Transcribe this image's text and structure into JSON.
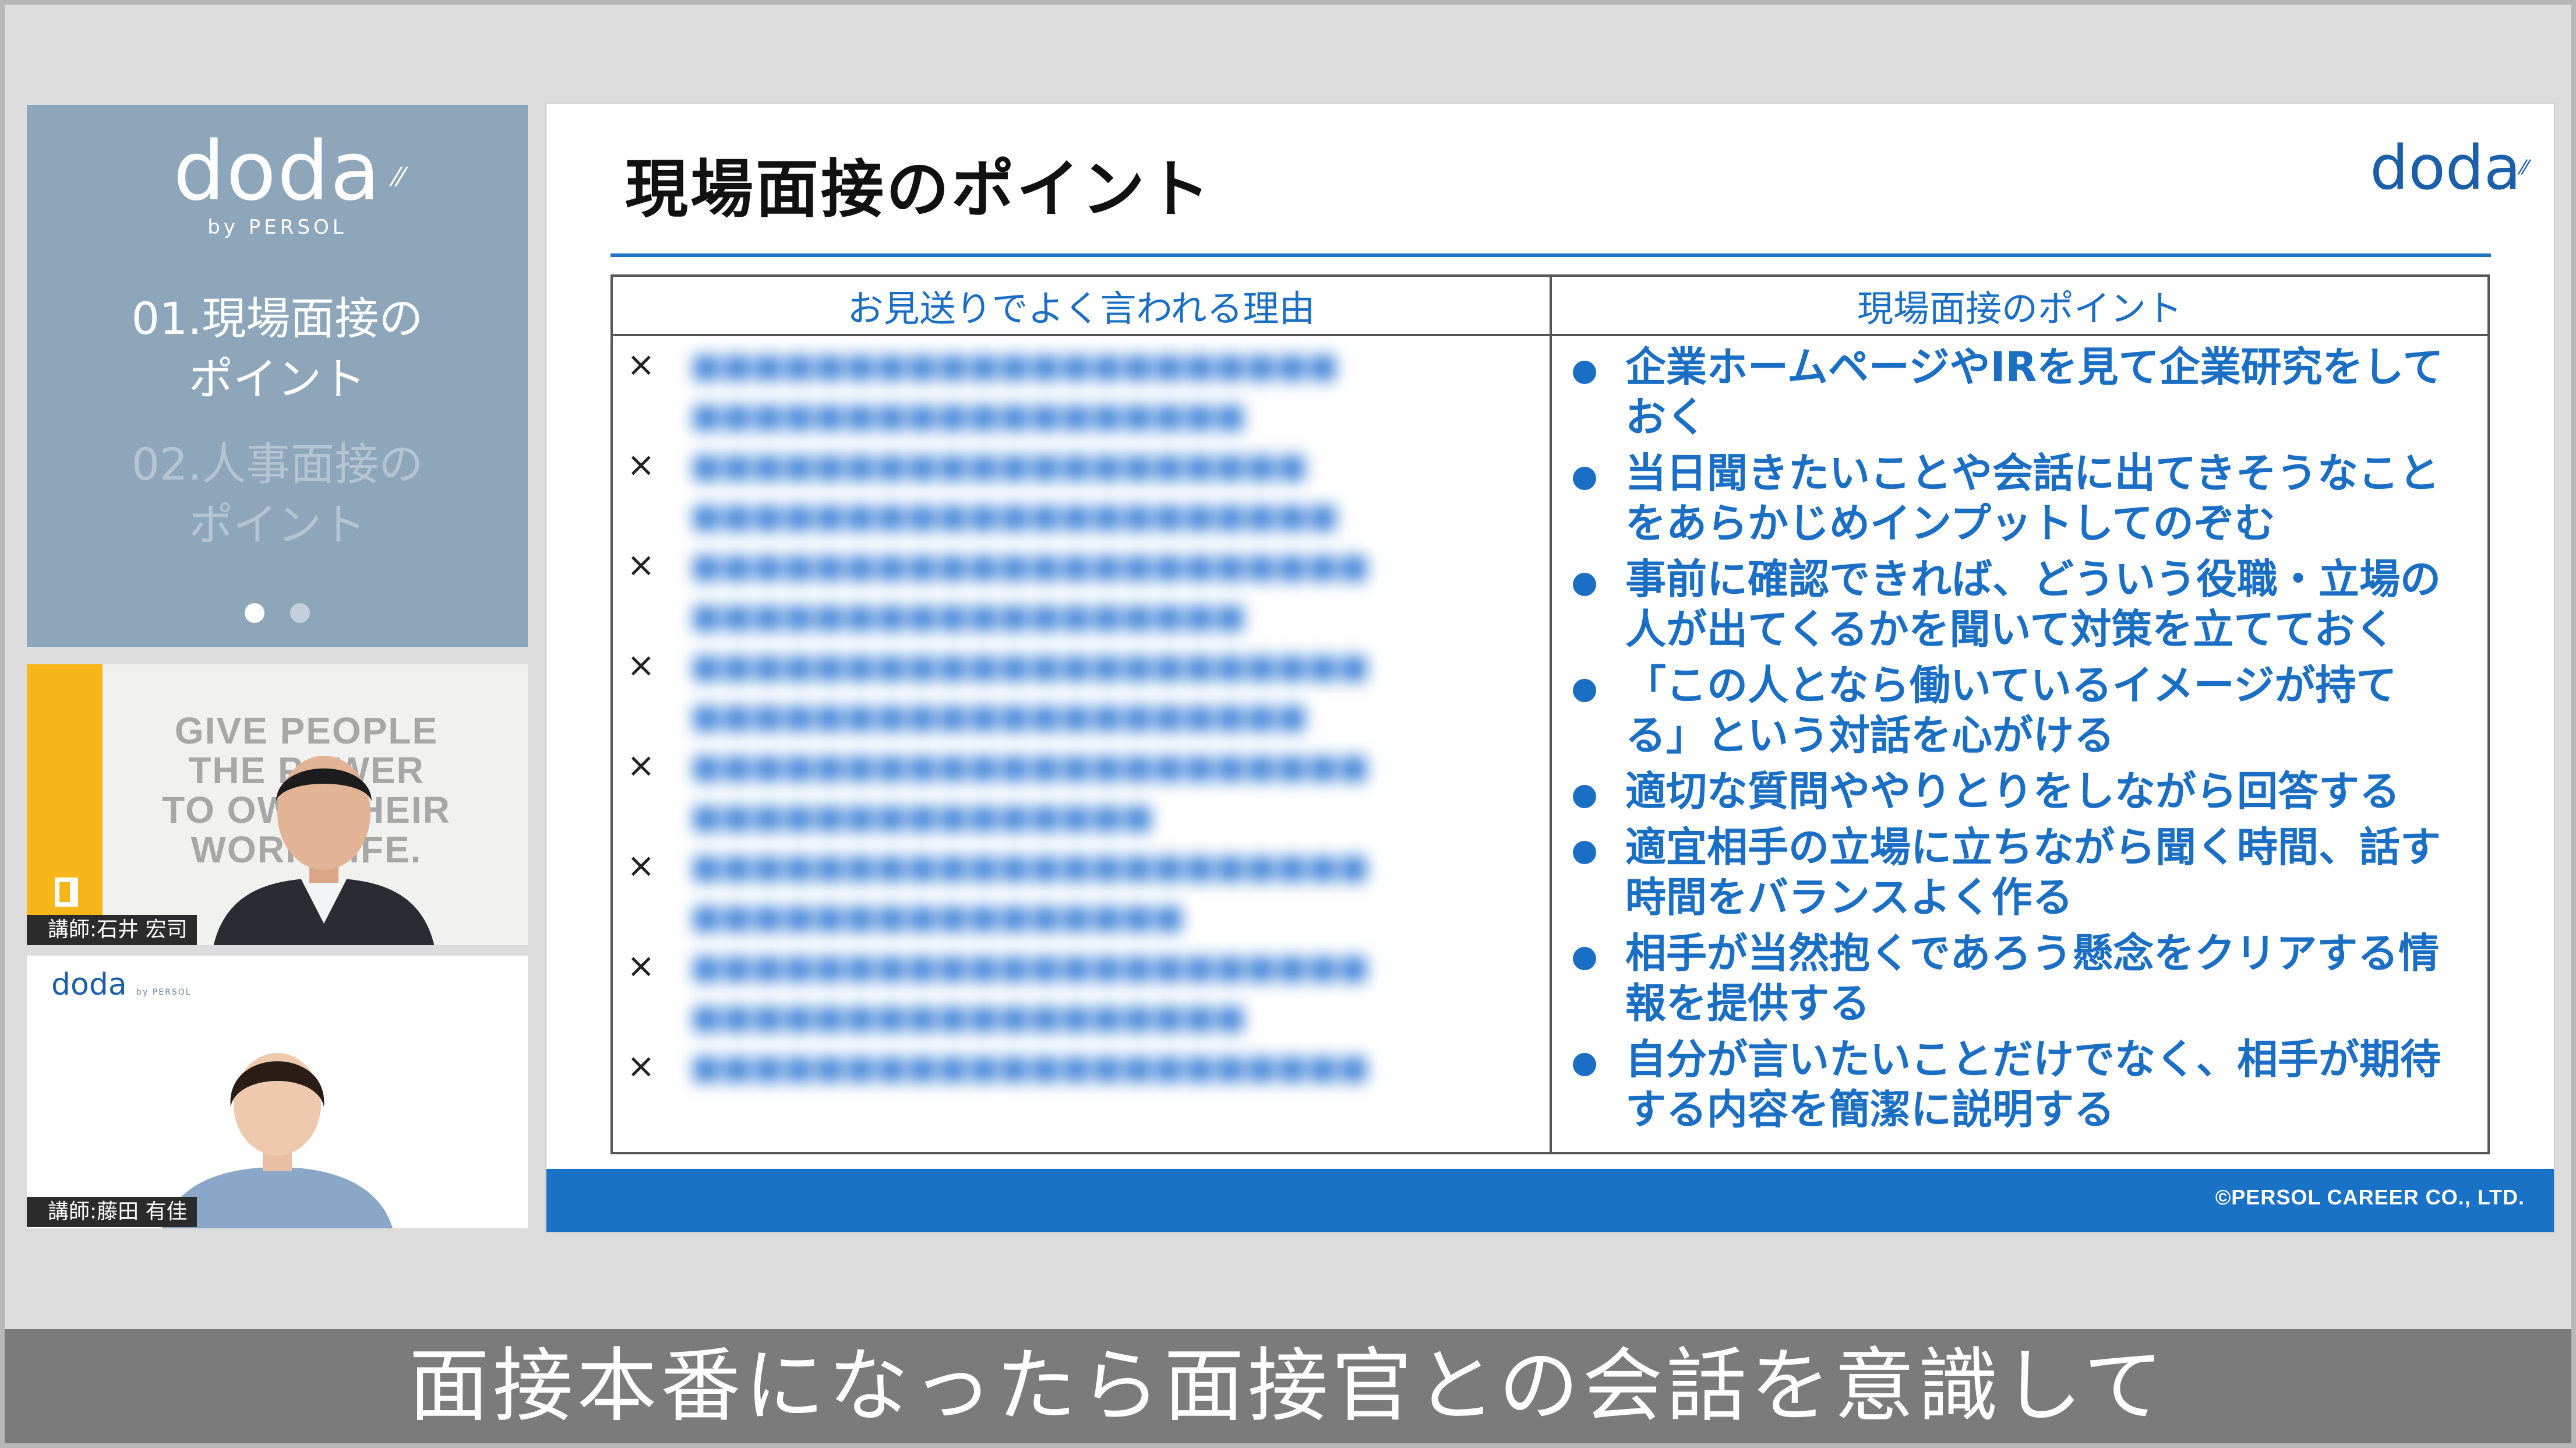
{
  "sidebar": {
    "logo_text": "doda",
    "logo_sub": "by PERSOL",
    "items": [
      {
        "label_line1": "01.現場面接の",
        "label_line2": "ポイント",
        "active": true
      },
      {
        "label_line1": "02.人事面接の",
        "label_line2": "ポイント",
        "active": false
      }
    ],
    "page_count": 2,
    "current_page": 1
  },
  "videos": [
    {
      "poster_lines": [
        "GIVE PEOPLE",
        "THE POWER",
        "TO OWN THEIR",
        "WORK LIFE."
      ],
      "name_tag": "講師:石井 宏司"
    },
    {
      "logo_text": "doda",
      "logo_sub": "by PERSOL",
      "name_tag": "講師:藤田 有佳"
    }
  ],
  "slide": {
    "title": "現場面接のポイント",
    "logo_text": "doda",
    "table": {
      "headers": [
        "お見送りでよく言われる理由",
        "現場面接のポイント"
      ],
      "reason_marker": "×",
      "reasons_count": 8,
      "points": [
        [
          "企業ホームページやIRを見て企業研究をして",
          "おく"
        ],
        [
          "当日聞きたいことや会話に出てきそうなこと",
          "をあらかじめインプットしてのぞむ"
        ],
        [
          "事前に確認できれば、どういう役職・立場の",
          "人が出てくるかを聞いて対策を立てておく"
        ],
        [
          "「この人となら働いているイメージが持て",
          "る」という対話を心がける"
        ],
        [
          "適切な質問ややりとりをしながら回答する"
        ],
        [
          "適宜相手の立場に立ちながら聞く時間、話す",
          "時間をバランスよく作る"
        ],
        [
          "相手が当然抱くであろう懸念をクリアする情",
          "報を提供する"
        ],
        [
          "自分が言いたいことだけでなく、相手が期待",
          "する内容を簡潔に説明する"
        ]
      ]
    },
    "footer": "©PERSOL CAREER CO., LTD."
  },
  "caption": "面接本番になったら面接官との会話を意識して",
  "colors": {
    "sidebar_bg": "#8ea6b9",
    "brand_blue": "#1a6ec4",
    "footer_blue": "#1a72c6",
    "caption_bg": "#7b7b7b",
    "accent_yellow": "#f6b619"
  }
}
